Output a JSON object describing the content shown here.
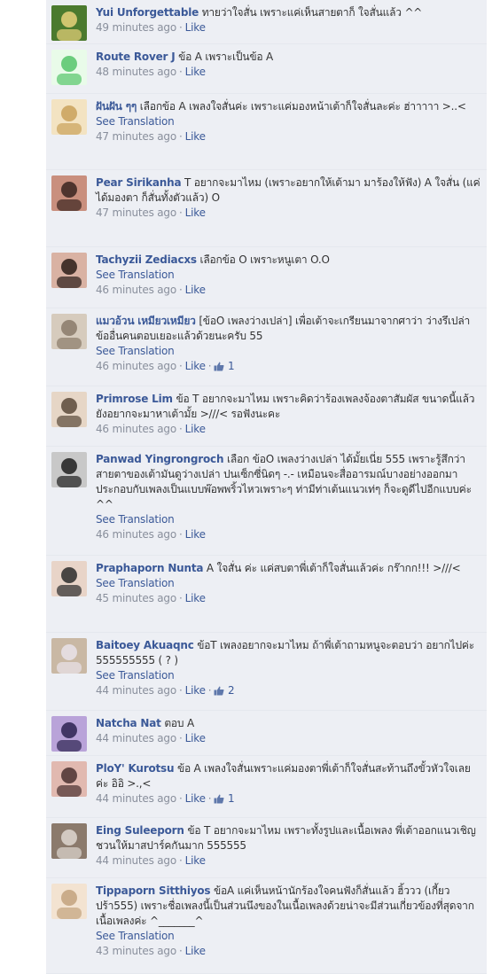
{
  "colors": {
    "link": "#3b5998",
    "meta": "#898f9c",
    "background": "#edeff4",
    "text": "#333333"
  },
  "labels": {
    "like": "Like",
    "see_translation": "See Translation",
    "like_icon": "thumbs-up-icon"
  },
  "comments": [
    {
      "author": "Yui Unforgettable",
      "text": "ทายว่าใจสั่น เพราะแค่เห็นสายตาก็ ใจสั่นแล้ว ^^",
      "time": "49 minutes ago",
      "translation": false,
      "likes": ""
    },
    {
      "author": "Route Rover J",
      "text": "ข้อ A เพราะเป็นข้อ A",
      "time": "48 minutes ago",
      "translation": false,
      "likes": ""
    },
    {
      "author": "ฝันฝัน ๆๆ",
      "text": "เลือกข้อ A เพลงใจสั่นค่ะ เพราะแค่มองหน้าเต้าก็ใจสั่นละค่ะ ฮ่าาาาา >..<",
      "time": "47 minutes ago",
      "translation": true,
      "likes": ""
    },
    {
      "author": "Pear Sirikanha",
      "text": "T อยากจะมาไหม (เพราะอยากให้เต้ามา มาร้องให้ฟัง) A ใจสั่น (แค่ได้มองตา ก็สั่นทั้งตัวแล้ว) O",
      "time": "47 minutes ago",
      "translation": false,
      "likes": ""
    },
    {
      "author": "Tachyzii Zediacxs",
      "text": "เลือกข้อ O เพราะหนูเตา O.O",
      "time": "46 minutes ago",
      "translation": true,
      "likes": ""
    },
    {
      "author": "แมวอ้วน เหมียวเหมียว",
      "text": "[ข้อO เพลงว่างเปล่า] เพื่อเต้าจะเกรียนมาจากศาว่า ว่างรึเปล่า ข้ออื่นคนตอบเยอะแล้วด้วยนะครับ 55",
      "time": "46 minutes ago",
      "translation": true,
      "likes": "1"
    },
    {
      "author": "Primrose Lim",
      "text": "ข้อ T อยากจะมาไหม เพราะคิดว่าร้องเพลงจ้องตาสัมผัส ขนาดนี้แล้วยังอยากจะมาหาเต้ามั้ย >///< รอฟังนะคะ",
      "time": "46 minutes ago",
      "translation": false,
      "likes": ""
    },
    {
      "author": "Panwad Yingrongroch",
      "text": "เลือก ข้อO เพลงว่างเปล่า ได้มั้ยเนี่ย 555 เพราะรู้สึกว่าสายตาของเต้ามันดูว่างเปล่า ปนเซ็กซี่นิดๆ -.- เหมือนจะสื่ออารมณ์บางอย่างออกมา ประกอบกับเพลงเป็นแบบพ๊อพพริ้วไหวเพราะๆ ท่ามีท่าเต้นแนวเท่ๆ ก็จะดูดีไปอีกแบบค่ะ ^^",
      "time": "46 minutes ago",
      "translation": true,
      "likes": ""
    },
    {
      "author": "Praphaporn Nunta",
      "text": "A ใจสั่น ค่ะ แค่สบตาพี่เต้าก็ใจสั่นแล้วค่ะ กร๊ากก!!! >///<",
      "time": "45 minutes ago",
      "translation": true,
      "likes": ""
    },
    {
      "author": "Baitoey Akuaqnc",
      "text": "ข้อT เพลงอยากจะมาไหม ถ้าพี่เต้าถามหนูจะตอบว่า อยากไปค่ะ 555555555 ( ? )",
      "time": "44 minutes ago",
      "translation": true,
      "likes": "2"
    },
    {
      "author": "Natcha Nat",
      "text": "ตอบ A",
      "time": "44 minutes ago",
      "translation": false,
      "likes": ""
    },
    {
      "author": "PloY' Kurotsu",
      "text": "ข้อ A เพลงใจสั่นเพราะแค่มองตาพี่เต้าก็ใจสั่นสะท้านถึงขั้วหัวใจเลยค่ะ อิอิ >.,<",
      "time": "44 minutes ago",
      "translation": false,
      "likes": "1"
    },
    {
      "author": "Eing Suleeporn",
      "text": "ข้อ T อยากจะมาไหม เพราะทั้งรูปและเนื้อเพลง พี่เต้าออกแนวเชิญชวนให้มาสปาร์คกันมาก 555555",
      "time": "44 minutes ago",
      "translation": false,
      "likes": ""
    },
    {
      "author": "Tippaporn Sitthiyos",
      "text": "ข้อA แค่เห็นหน้านักร้องใจคนฟังก็สั่นแล้ว ฮิ้ววว (เกี้ยวปร้า555) เพราะชื่อเพลงนี้เป็นส่วนนึงของในเนื้อเพลงด้วยน่าจะมีส่วนเกี่ยวข้องที่สุดจากเนื้อเพลงค่ะ ^_______^",
      "time": "43 minutes ago",
      "translation": true,
      "likes": ""
    }
  ]
}
